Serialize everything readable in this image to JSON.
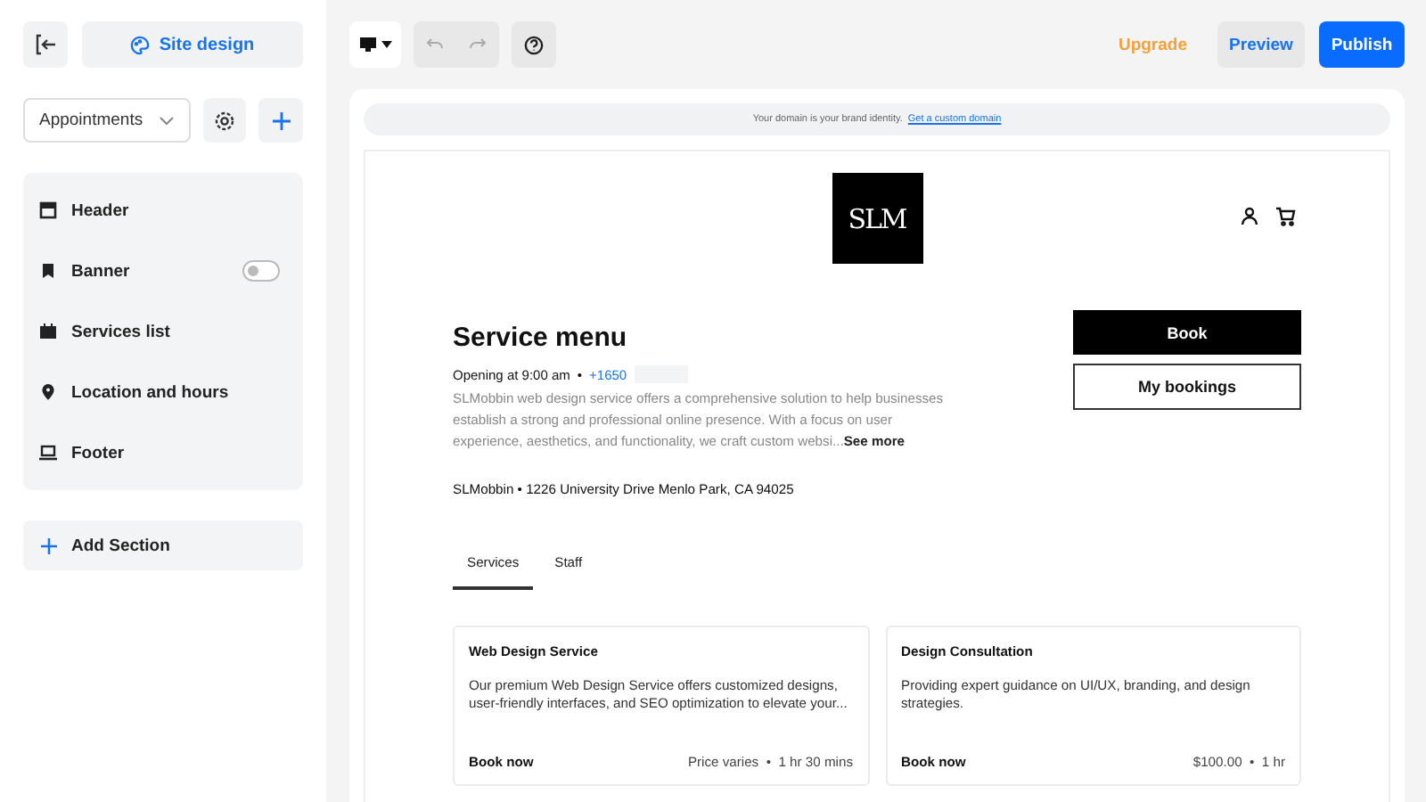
{
  "sidebar": {
    "site_design": "Site design",
    "page_select": "Appointments",
    "sections": [
      {
        "label": "Header"
      },
      {
        "label": "Banner",
        "toggle": {
          "on": false
        }
      },
      {
        "label": "Services list"
      },
      {
        "label": "Location and hours"
      },
      {
        "label": "Footer"
      }
    ],
    "add_section": "Add Section"
  },
  "toolbar": {
    "upgrade": "Upgrade",
    "preview": "Preview",
    "publish": "Publish"
  },
  "preview": {
    "domain_notice": "Your domain is your brand identity.",
    "domain_link": "Get a custom domain",
    "logo": "SLM",
    "title": "Service menu",
    "opening": "Opening at 9:00 am",
    "separator": "•",
    "phone": "+1650",
    "description": "SLMobbin web design service offers a comprehensive solution to help businesses establish a strong and professional online presence. With a focus on user experience, aesthetics, and functionality, we craft custom websi...",
    "see_more": "See more",
    "address": "SLMobbin • 1226 University Drive Menlo Park, CA 94025",
    "book": "Book",
    "my_bookings": "My bookings",
    "tabs": [
      {
        "label": "Services",
        "selected": true
      },
      {
        "label": "Staff",
        "selected": false
      }
    ],
    "cards": [
      {
        "title": "Web Design Service",
        "description": "Our premium Web Design Service offers customized designs, user-friendly interfaces, and SEO optimization to elevate your...",
        "action": "Book now",
        "meta": "Price varies  •  1 hr 30 mins"
      },
      {
        "title": "Design Consultation",
        "description": "Providing expert guidance on UI/UX, branding, and design strategies.",
        "action": "Book now",
        "meta": "$100.00  •  1 hr"
      }
    ]
  }
}
